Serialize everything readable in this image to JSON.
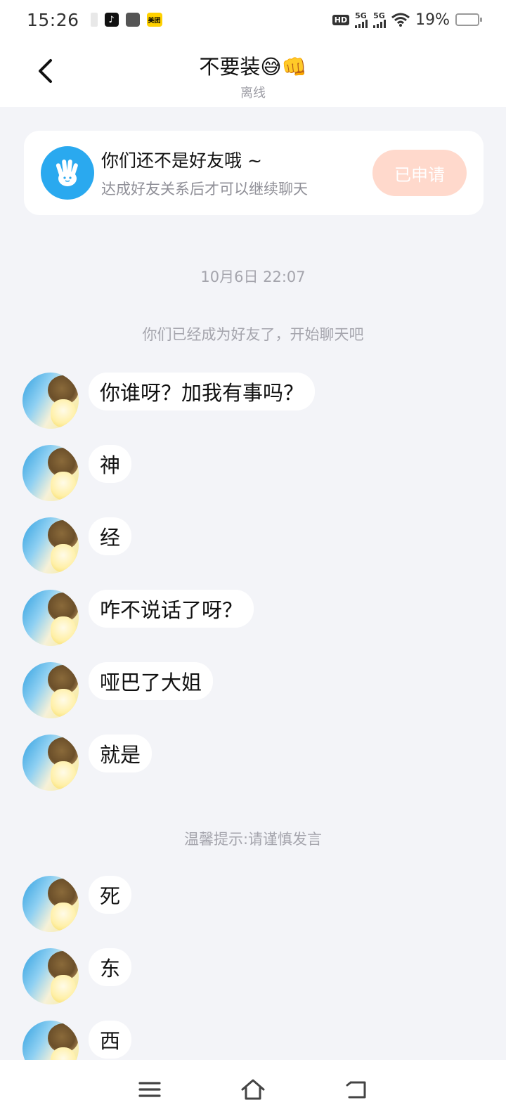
{
  "status_bar": {
    "time": "15:26",
    "battery": "19%",
    "battery_level": 0.19,
    "app_icons": [
      "tiktok-icon",
      "app-icon",
      "meituan-icon"
    ],
    "meituan_label": "美团"
  },
  "header": {
    "title": "不要装😅👊",
    "subtitle": "离线"
  },
  "friend_card": {
    "title": "你们还不是好友哦 ~",
    "subtitle": "达成好友关系后才可以继续聊天",
    "button_label": "已申请"
  },
  "timestamp": "10月6日 22:07",
  "system_notice": "你们已经成为好友了，开始聊天吧",
  "messages_1": [
    {
      "text": "你谁呀？加我有事吗？"
    },
    {
      "text": "神"
    },
    {
      "text": "经"
    },
    {
      "text": "咋不说话了呀？"
    },
    {
      "text": "哑巴了大姐"
    },
    {
      "text": "就是"
    }
  ],
  "warning_notice": "温馨提示:请谨慎发言",
  "messages_2": [
    {
      "text": "死"
    },
    {
      "text": "东"
    },
    {
      "text": "西"
    }
  ],
  "colors": {
    "accent_blue": "#2aa9ef",
    "applied_button_bg": "#ffd9cc",
    "background": "#f3f4f8"
  }
}
